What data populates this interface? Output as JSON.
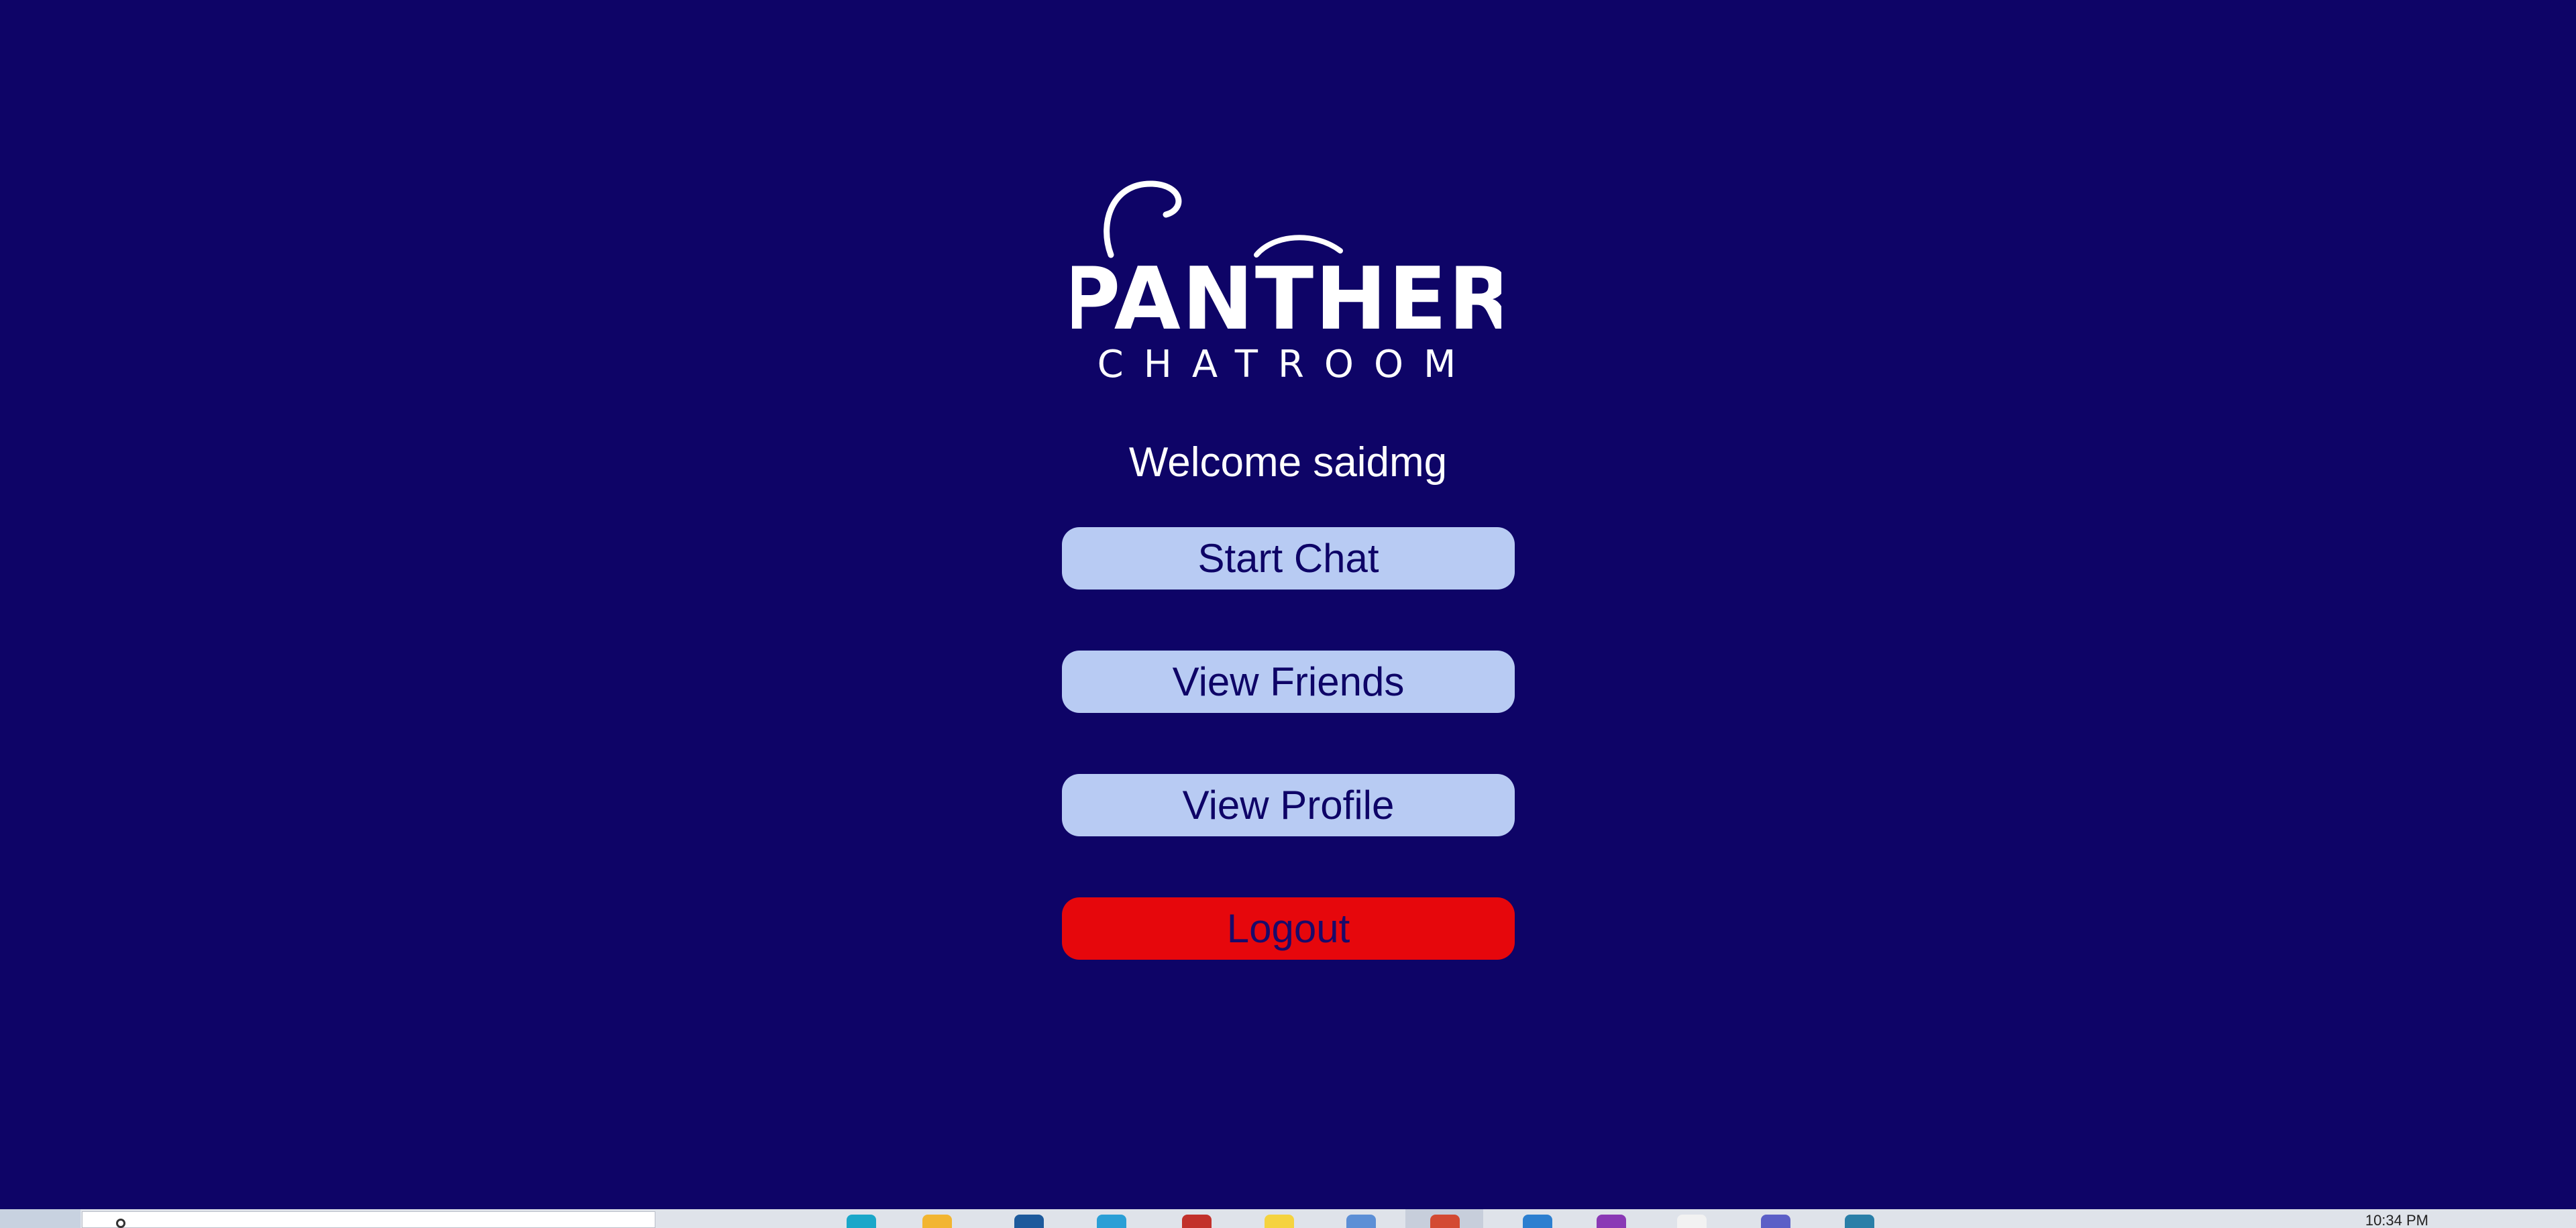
{
  "logo": {
    "line1": "PANTHER",
    "line2": "CHATROOM"
  },
  "welcome": {
    "text": "Welcome saidmg"
  },
  "menu": {
    "start_chat": "Start Chat",
    "view_friends": "View Friends",
    "view_profile": "View Profile",
    "logout": "Logout"
  },
  "taskbar": {
    "clock": "10:34 PM",
    "apps": [
      {
        "icon": "edge-icon",
        "color": "#1aa7c9"
      },
      {
        "icon": "file-explorer-icon",
        "color": "#f2b531"
      },
      {
        "icon": "store-icon",
        "color": "#1d5a9c"
      },
      {
        "icon": "mail-icon",
        "color": "#2a9fd6"
      },
      {
        "icon": "office-icon",
        "color": "#c2312b"
      },
      {
        "icon": "sticky-notes-icon",
        "color": "#f5d33f"
      },
      {
        "icon": "photos-icon",
        "color": "#5c8fd6"
      },
      {
        "icon": "chrome-icon",
        "color": "#d34a33"
      },
      {
        "icon": "vscode-icon",
        "color": "#2c7fd0"
      },
      {
        "icon": "app-purple-icon",
        "color": "#8a39b5"
      },
      {
        "icon": "app-white-icon",
        "color": "#f2f2f2"
      },
      {
        "icon": "teams-icon",
        "color": "#5b5fc7"
      },
      {
        "icon": "app-blue-icon",
        "color": "#2a7fa8"
      }
    ]
  },
  "colors": {
    "background": "#0e0467",
    "button": "#b8cbf3",
    "button_text": "#0e0467",
    "logout": "#e6070c"
  }
}
